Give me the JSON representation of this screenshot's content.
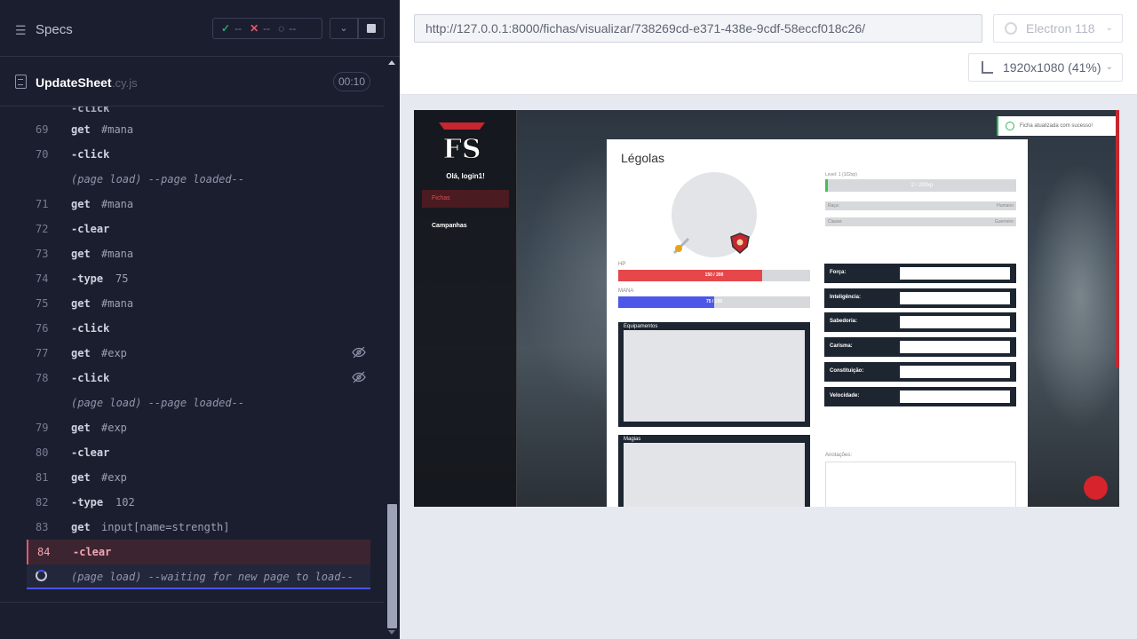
{
  "runner": {
    "specs_label": "Specs",
    "stats": {
      "passed": "--",
      "failed": "--",
      "pending": "--"
    },
    "file": {
      "name": "UpdateSheet",
      "ext": ".cy.js",
      "duration": "00:10"
    }
  },
  "commands": [
    {
      "num": "69",
      "name": "get",
      "msg": "#mana"
    },
    {
      "num": "70",
      "name": "-click",
      "msg": ""
    },
    {
      "num": "",
      "event": "(page load)  --page loaded--"
    },
    {
      "num": "71",
      "name": "get",
      "msg": "#mana"
    },
    {
      "num": "72",
      "name": "-clear",
      "msg": ""
    },
    {
      "num": "73",
      "name": "get",
      "msg": "#mana"
    },
    {
      "num": "74",
      "name": "-type",
      "msg": "75"
    },
    {
      "num": "75",
      "name": "get",
      "msg": "#mana"
    },
    {
      "num": "76",
      "name": "-click",
      "msg": ""
    },
    {
      "num": "77",
      "name": "get",
      "msg": "#exp"
    },
    {
      "num": "78",
      "name": "-click",
      "msg": ""
    },
    {
      "num": "",
      "event": "(page load)  --page loaded--"
    },
    {
      "num": "79",
      "name": "get",
      "msg": "#exp"
    },
    {
      "num": "80",
      "name": "-clear",
      "msg": ""
    },
    {
      "num": "81",
      "name": "get",
      "msg": "#exp"
    },
    {
      "num": "82",
      "name": "-type",
      "msg": "102"
    },
    {
      "num": "83",
      "name": "get",
      "msg": "input[name=strength]"
    },
    {
      "num": "84",
      "name": "-clear",
      "msg": ""
    },
    {
      "num": "",
      "event": "(page load)  --waiting for new page to load--"
    }
  ],
  "browser_bar": {
    "url": "http://127.0.0.1:8000/fichas/visualizar/738269cd-e371-438e-9cdf-58eccf018c26/",
    "browser": "Electron 118",
    "viewport": "1920x1080  (41%)"
  },
  "app": {
    "logo": "FS",
    "greeting": "Olá, login1!",
    "nav": [
      "Fichas",
      "Campanhas"
    ],
    "toast": "Ficha atualizada com sucesso!",
    "character": "Légolas",
    "level_label": "Level: 1 (102xp)",
    "level_value": "2 / 200xp",
    "race_label": "Raça:",
    "race_value": "Humano",
    "class_label": "Classe:",
    "class_value": "Guerreiro",
    "hp_label": "HP",
    "hp_value": "150 / 200",
    "hp_fraction": 0.75,
    "mana_label": "MANA",
    "mana_value": "75 / 150",
    "mana_fraction": 0.5,
    "attributes": [
      "Força:",
      "Inteligência:",
      "Sabedoria:",
      "Carisma:",
      "Constituição:",
      "Velocidade:"
    ],
    "equip_label": "Equipamentos",
    "magic_label": "Magias",
    "notes_label": "Anotações:"
  },
  "colors": {
    "accent": "#4956e3",
    "fail": "#e45770",
    "pass": "#1fa971",
    "hp": "#e5474b",
    "mana": "#4e58e8"
  }
}
